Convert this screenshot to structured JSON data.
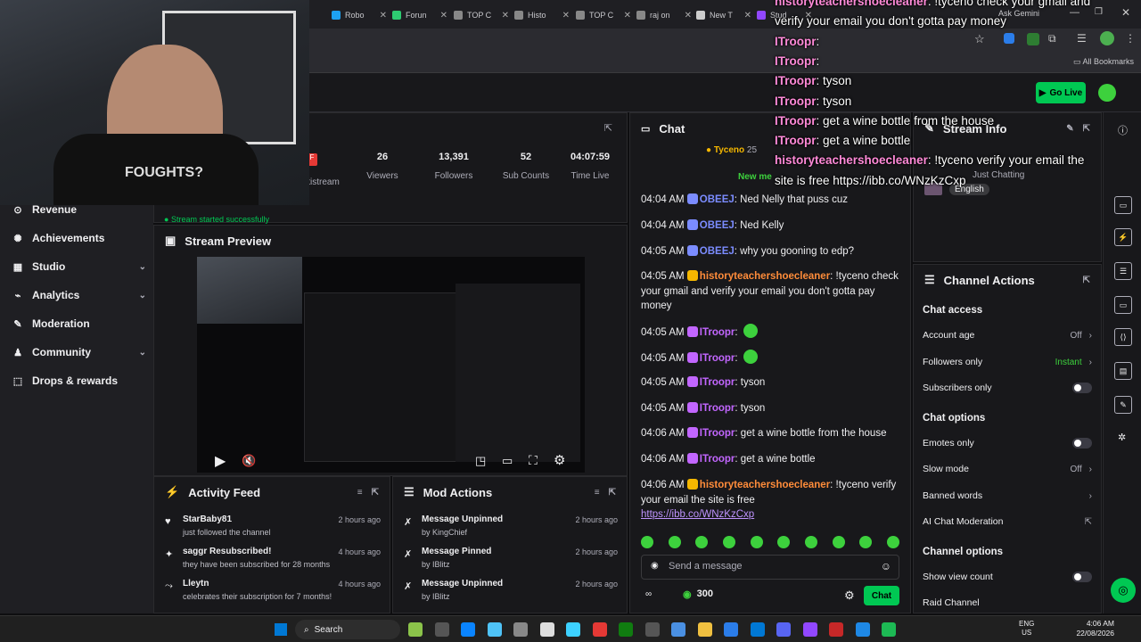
{
  "browser": {
    "tabs": [
      {
        "label": "Robo",
        "color": "#1da1f2"
      },
      {
        "label": "Forun",
        "color": "#2ecc71"
      },
      {
        "label": "TOP C",
        "color": "#888888"
      },
      {
        "label": "Histo",
        "color": "#888888"
      },
      {
        "label": "TOP C",
        "color": "#888888"
      },
      {
        "label": "raj on",
        "color": "#888888"
      },
      {
        "label": "New T",
        "color": "#cccccc"
      },
      {
        "label": "Stud",
        "color": "#9147ff"
      }
    ],
    "ask_gemini": "Ask Gemini",
    "bookmarks_label": "All Bookmarks"
  },
  "topnav": {
    "go_live": "Go Live"
  },
  "sidebar": {
    "items": [
      {
        "label": "Revenue",
        "chevron": false
      },
      {
        "label": "Achievements",
        "chevron": false
      },
      {
        "label": "Studio",
        "chevron": true
      },
      {
        "label": "Analytics",
        "chevron": true
      },
      {
        "label": "Moderation",
        "chevron": false
      },
      {
        "label": "Community",
        "chevron": true
      },
      {
        "label": "Drops & rewards",
        "chevron": false
      }
    ]
  },
  "stats": {
    "multistream": "ltistream",
    "viewers": {
      "value": "26",
      "label": "Viewers"
    },
    "followers": {
      "value": "13,391",
      "label": "Followers"
    },
    "subs": {
      "value": "52",
      "label": "Sub Counts"
    },
    "time": {
      "value": "04:07:59",
      "label": "Time Live"
    },
    "status": "Stream started successfully"
  },
  "preview": {
    "title": "Stream Preview"
  },
  "activity": {
    "title": "Activity Feed",
    "items": [
      {
        "name": "StarBaby81",
        "desc": "just followed the channel",
        "time": "2 hours ago"
      },
      {
        "name": "saggr Resubscribed!",
        "desc": "they have been subscribed for 28 months",
        "time": "4 hours ago"
      },
      {
        "name": "Lleytn",
        "desc": "celebrates their subscription for 7 months!",
        "time": "4 hours ago"
      }
    ]
  },
  "modactions": {
    "title": "Mod Actions",
    "items": [
      {
        "action": "Message Unpinned",
        "by": "by KingChief",
        "time": "2 hours ago"
      },
      {
        "action": "Message Pinned",
        "by": "by IBlitz",
        "time": "2 hours ago"
      },
      {
        "action": "Message Unpinned",
        "by": "by IBlitz",
        "time": "2 hours ago"
      }
    ]
  },
  "chat": {
    "title": "Chat",
    "pinned_user": "Tyceno",
    "pinned_count": "25",
    "new_messages": "New me",
    "messages": [
      {
        "time": "04:04 AM",
        "user": "OBEEJ",
        "text": ": Ned Nelly that puss cuz"
      },
      {
        "time": "04:04 AM",
        "user": "OBEEJ",
        "text": ": Ned Kelly"
      },
      {
        "time": "04:05 AM",
        "user": "OBEEJ",
        "text": ": why you gooning to edp?"
      },
      {
        "time": "04:05 AM",
        "user": "historyteachershoecleaner",
        "text": ": !tyceno check your gmail and verify your email you don't gotta pay money"
      },
      {
        "time": "04:05 AM",
        "user": "ITroopr",
        "text": ":"
      },
      {
        "time": "04:05 AM",
        "user": "ITroopr",
        "text": ":"
      },
      {
        "time": "04:05 AM",
        "user": "ITroopr",
        "text": ": tyson"
      },
      {
        "time": "04:05 AM",
        "user": "ITroopr",
        "text": ": tyson"
      },
      {
        "time": "04:06 AM",
        "user": "ITroopr",
        "text": ": get a wine bottle from the house"
      },
      {
        "time": "04:06 AM",
        "user": "ITroopr",
        "text": ": get a wine bottle"
      },
      {
        "time": "04:06 AM",
        "user": "historyteachershoecleaner",
        "text": ": !tyceno verify your email the site is free"
      }
    ],
    "link": "https://ibb.co/WNzKzCxp",
    "input_placeholder": "Send a message",
    "points": "300",
    "send_label": "Chat"
  },
  "streaminfo": {
    "title": "Stream Info",
    "game": "Just Chatting",
    "lang": "English"
  },
  "channel_actions": {
    "title": "Channel Actions",
    "chat_access": "Chat access",
    "account_age": {
      "label": "Account age",
      "value": "Off"
    },
    "followers_only": {
      "label": "Followers only",
      "value": "Instant"
    },
    "subscribers_only": {
      "label": "Subscribers only"
    },
    "chat_options": "Chat options",
    "emotes_only": {
      "label": "Emotes only"
    },
    "slow_mode": {
      "label": "Slow mode",
      "value": "Off"
    },
    "banned_words": {
      "label": "Banned words"
    },
    "ai_mod": {
      "label": "AI Chat Moderation"
    },
    "channel_options": "Channel options",
    "show_view_count": {
      "label": "Show view count"
    },
    "raid_channel": {
      "label": "Raid Channel"
    }
  },
  "overlay": {
    "lines": [
      {
        "name": "historyteachershoecleaner",
        "text": ": !tyceno check your gmail and"
      },
      {
        "name": "",
        "text": "verify your email you don't gotta pay money"
      },
      {
        "name": "ITroopr",
        "text": ":"
      },
      {
        "name": "ITroopr",
        "text": ":"
      },
      {
        "name": "ITroopr",
        "text": ": tyson"
      },
      {
        "name": "ITroopr",
        "text": ": tyson"
      },
      {
        "name": "ITroopr",
        "text": ": get a wine bottle from the house"
      },
      {
        "name": "ITroopr",
        "text": ": get a wine bottle"
      },
      {
        "name": "historyteachershoecleaner",
        "text": ": !tyceno verify your email the"
      },
      {
        "name": "",
        "text": "site is free https://ibb.co/WNzKzCxp"
      }
    ]
  },
  "webcam": {
    "shirt": "FOUGHTS?"
  },
  "taskbar": {
    "search": "Search",
    "lang": "ENG",
    "region": "US",
    "clock": "4:06 AM",
    "date": "22/08/2026"
  }
}
